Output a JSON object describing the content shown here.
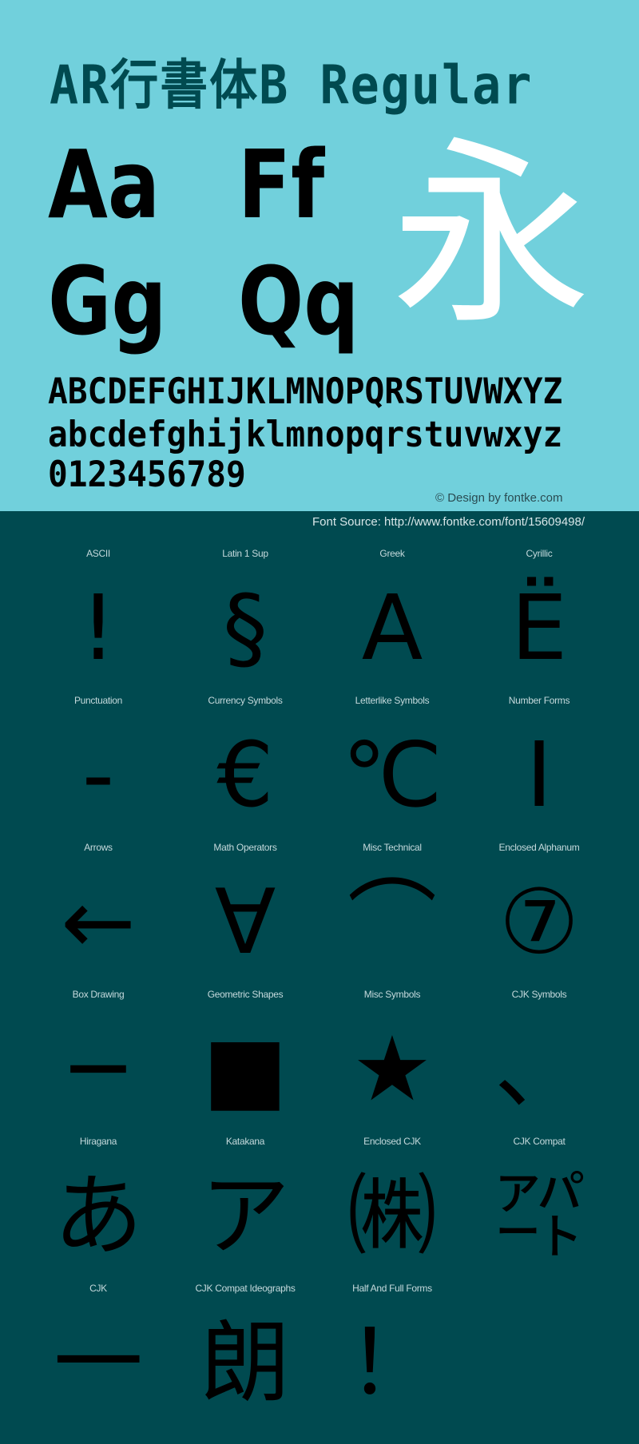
{
  "header": {
    "title": "AR行書体B Regular"
  },
  "sample_pairs": [
    "Aa",
    "Ff",
    "Gg",
    "Qq"
  ],
  "feature_glyph": "永",
  "alphabet": {
    "uppercase": "ABCDEFGHIJKLMNOPQRSTUVWXYZ",
    "lowercase": "abcdefghijklmnopqrstuvwxyz",
    "digits": "0123456789"
  },
  "credit": "© Design by fontke.com",
  "source": "Font Source: http://www.fontke.com/font/15609498/",
  "colors": {
    "top_background": "#71d0dc",
    "bottom_background": "#004a50",
    "title_color": "#004a50",
    "feature_glyph_color": "#ffffff"
  },
  "blocks": [
    {
      "label": "ASCII",
      "glyph": "!"
    },
    {
      "label": "Latin 1 Sup",
      "glyph": "§"
    },
    {
      "label": "Greek",
      "glyph": "Α"
    },
    {
      "label": "Cyrillic",
      "glyph": "Ё"
    },
    {
      "label": "Punctuation",
      "glyph": "‐"
    },
    {
      "label": "Currency Symbols",
      "glyph": "€"
    },
    {
      "label": "Letterlike Symbols",
      "glyph": "℃"
    },
    {
      "label": "Number Forms",
      "glyph": "Ⅰ"
    },
    {
      "label": "Arrows",
      "glyph": "←"
    },
    {
      "label": "Math Operators",
      "glyph": "∀"
    },
    {
      "label": "Misc Technical",
      "glyph": "⌒"
    },
    {
      "label": "Enclosed Alphanum",
      "glyph": "⑦"
    },
    {
      "label": "Box Drawing",
      "glyph": "─"
    },
    {
      "label": "Geometric Shapes",
      "glyph": "■"
    },
    {
      "label": "Misc Symbols",
      "glyph": "★"
    },
    {
      "label": "CJK Symbols",
      "glyph": "、"
    },
    {
      "label": "Hiragana",
      "glyph": "あ"
    },
    {
      "label": "Katakana",
      "glyph": "ア"
    },
    {
      "label": "Enclosed CJK",
      "glyph": "㈱"
    },
    {
      "label": "CJK Compat",
      "glyph": "㌀"
    },
    {
      "label": "CJK",
      "glyph": "一"
    },
    {
      "label": "CJK Compat Ideographs",
      "glyph": "朗"
    },
    {
      "label": "Half And Full Forms",
      "glyph": "！"
    }
  ]
}
